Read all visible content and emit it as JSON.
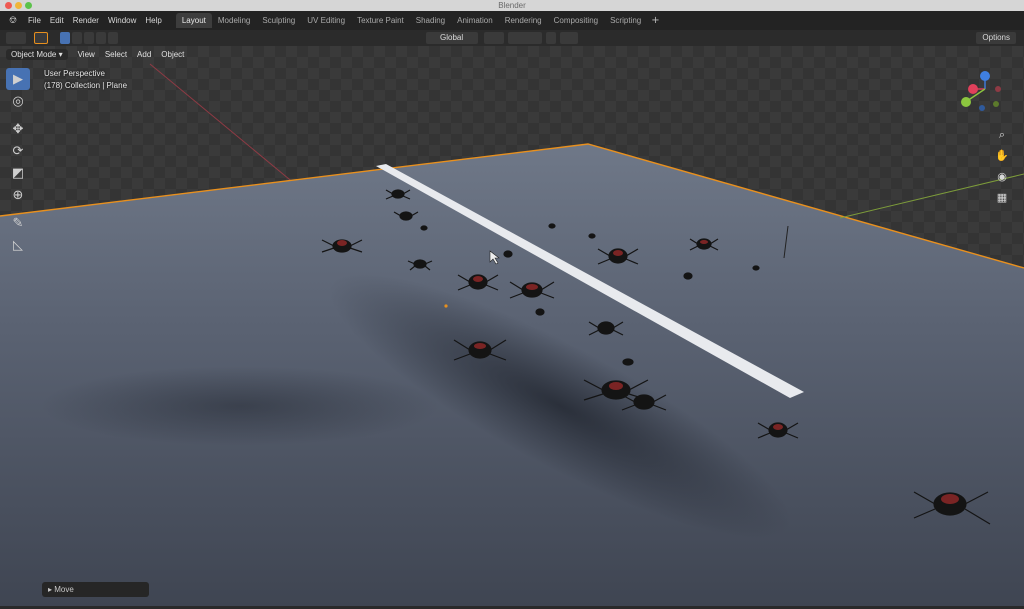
{
  "window": {
    "title": "Blender"
  },
  "topbar": {
    "logo_icon": "blender-logo-icon",
    "menus": [
      "File",
      "Edit",
      "Render",
      "Window",
      "Help"
    ],
    "workspaces": [
      "Layout",
      "Modeling",
      "Sculpting",
      "UV Editing",
      "Texture Paint",
      "Shading",
      "Animation",
      "Rendering",
      "Compositing",
      "Scripting"
    ],
    "active_workspace": "Layout",
    "add_workspace_icon": "plus-icon"
  },
  "header": {
    "transform_orientation": "Global",
    "options_label": "Options"
  },
  "viewport": {
    "mode": "Object Mode",
    "menus": [
      "View",
      "Select",
      "Add",
      "Object"
    ],
    "info_line1": "User Perspective",
    "info_line2": "(178) Collection | Plane",
    "last_operator": "Move"
  },
  "colors": {
    "accent": "#4772b3",
    "selection_outline": "#e8901e",
    "axis_x": "#e0405b",
    "axis_y": "#8cc63f",
    "axis_z": "#3f7fe0"
  },
  "icons": {
    "tools": [
      "select-box-icon",
      "cursor-icon",
      "move-icon",
      "rotate-icon",
      "scale-icon",
      "transform-icon",
      "annotate-icon",
      "measure-icon"
    ],
    "navigation": [
      "zoom-icon",
      "pan-hand-icon",
      "camera-icon",
      "grid-view-icon"
    ]
  }
}
